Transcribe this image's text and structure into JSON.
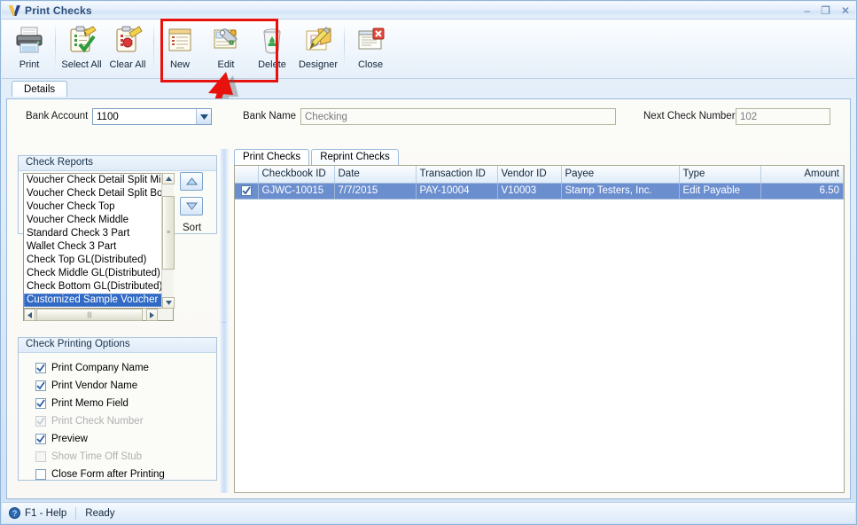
{
  "window": {
    "title": "Print Checks",
    "logo_icon": "v-logo-icon",
    "minimize_label": "–",
    "maximize_label": "❐",
    "close_label": "✕"
  },
  "toolbar": {
    "buttons": [
      {
        "label": "Print",
        "icon": "printer-icon"
      },
      {
        "label": "Select All",
        "icon": "clipboard-check-icon"
      },
      {
        "label": "Clear All",
        "icon": "clipboard-erase-icon"
      },
      {
        "label": "New",
        "icon": "new-document-icon"
      },
      {
        "label": "Edit",
        "icon": "wrench-edit-icon"
      },
      {
        "label": "Delete",
        "icon": "recycle-bin-icon"
      },
      {
        "label": "Designer",
        "icon": "designer-pencil-icon"
      },
      {
        "label": "Close",
        "icon": "close-window-icon"
      }
    ],
    "highlight_color": "#e8120c",
    "annotation": {
      "type": "arrow",
      "color": "#e8120c",
      "points_at": "Edit, Delete, Designer buttons"
    }
  },
  "tabs": {
    "details": "Details"
  },
  "form": {
    "bank_account_label": "Bank Account",
    "bank_account_value": "1100",
    "bank_name_label": "Bank Name",
    "bank_name_value": "Checking",
    "next_check_number_label": "Next Check Number",
    "next_check_number_value": "102"
  },
  "check_reports": {
    "title": "Check Reports",
    "items": [
      "Voucher Check Detail Split Middle",
      "Voucher Check Detail Split Bottom",
      "Voucher Check Top",
      "Voucher Check Middle",
      "Standard Check 3 Part",
      "Wallet Check 3 Part",
      "Check Top GL(Distributed)",
      "Check Middle GL(Distributed)",
      "Check Bottom GL(Distributed)",
      "Customized Sample Voucher Detail"
    ],
    "selected_index": 9,
    "sort_label": "Sort",
    "sort_up_icon": "triangle-up-icon",
    "sort_down_icon": "triangle-down-icon"
  },
  "printing_options": {
    "title": "Check Printing Options",
    "items": [
      {
        "label": "Print Company Name",
        "checked": true,
        "enabled": true
      },
      {
        "label": "Print Vendor Name",
        "checked": true,
        "enabled": true
      },
      {
        "label": "Print Memo Field",
        "checked": true,
        "enabled": true
      },
      {
        "label": "Print Check Number",
        "checked": true,
        "enabled": false
      },
      {
        "label": "Preview",
        "checked": true,
        "enabled": true
      },
      {
        "label": "Show Time Off Stub",
        "checked": false,
        "enabled": false
      },
      {
        "label": "Close Form after Printing",
        "checked": false,
        "enabled": true
      }
    ]
  },
  "grid": {
    "tabs": [
      {
        "label": "Print Checks",
        "active": true
      },
      {
        "label": "Reprint Checks",
        "active": false
      }
    ],
    "columns": [
      "",
      "Checkbook ID",
      "Date",
      "Transaction ID",
      "Vendor ID",
      "Payee",
      "Type",
      "Amount"
    ],
    "rows": [
      {
        "selected": true,
        "checked": true,
        "checkbook_id": "GJWC-10015",
        "date": "7/7/2015",
        "transaction_id": "PAY-10004",
        "vendor_id": "V10003",
        "payee": "Stamp Testers, Inc.",
        "type": "Edit Payable",
        "amount": "6.50"
      }
    ]
  },
  "statusbar": {
    "help_icon": "help-question-icon",
    "help_label": "F1 - Help",
    "status_label": "Ready"
  }
}
